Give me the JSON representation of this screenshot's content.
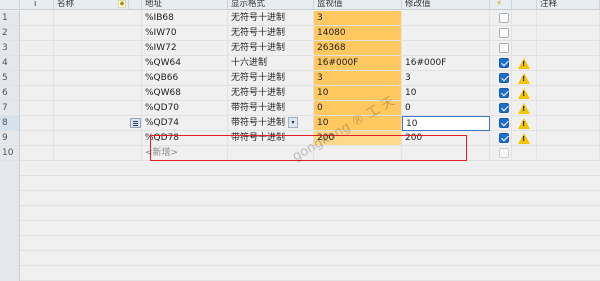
{
  "headers": {
    "info": "i",
    "name": "名称",
    "address": "地址",
    "format": "显示格式",
    "monitor": "监视值",
    "modify": "修改值",
    "lightning": "⚡",
    "comment": "注释"
  },
  "rows": [
    {
      "num": "1",
      "address": "%IB68",
      "format": "无符号十进制",
      "monitor": "3",
      "modify": "",
      "checked": false,
      "warn": false
    },
    {
      "num": "2",
      "address": "%IW70",
      "format": "无符号十进制",
      "monitor": "14080",
      "modify": "",
      "checked": false,
      "warn": false
    },
    {
      "num": "3",
      "address": "%IW72",
      "format": "无符号十进制",
      "monitor": "26368",
      "modify": "",
      "checked": false,
      "warn": false
    },
    {
      "num": "4",
      "address": "%QW64",
      "format": "十六进制",
      "monitor": "16#000F",
      "modify": "16#000F",
      "checked": true,
      "warn": true
    },
    {
      "num": "5",
      "address": "%QB66",
      "format": "无符号十进制",
      "monitor": "3",
      "modify": "3",
      "checked": true,
      "warn": true
    },
    {
      "num": "6",
      "address": "%QW68",
      "format": "无符号十进制",
      "monitor": "10",
      "modify": "10",
      "checked": true,
      "warn": true
    },
    {
      "num": "7",
      "address": "%QD70",
      "format": "带符号十进制",
      "monitor": "0",
      "modify": "0",
      "checked": true,
      "warn": true
    },
    {
      "num": "8",
      "address": "%QD74",
      "format": "带符号十进制",
      "monitor": "10",
      "modify": "10",
      "checked": true,
      "warn": true
    },
    {
      "num": "9",
      "address": "%QD78",
      "format": "带符号十进制",
      "monitor": "200",
      "modify": "200",
      "checked": true,
      "warn": true
    },
    {
      "num": "10",
      "address": "<新增>",
      "format": "",
      "monitor": "",
      "modify": "",
      "checked": false,
      "warn": false
    }
  ],
  "watermark": "gongkong ® 工 天",
  "warn_glyph": "!",
  "dropdown_glyph": "▾",
  "colors": {
    "monitor_bg": "#ffc861",
    "highlight_border": "#e02020",
    "checkbox_on": "#1a6fcf",
    "warning": "#f5c400"
  }
}
